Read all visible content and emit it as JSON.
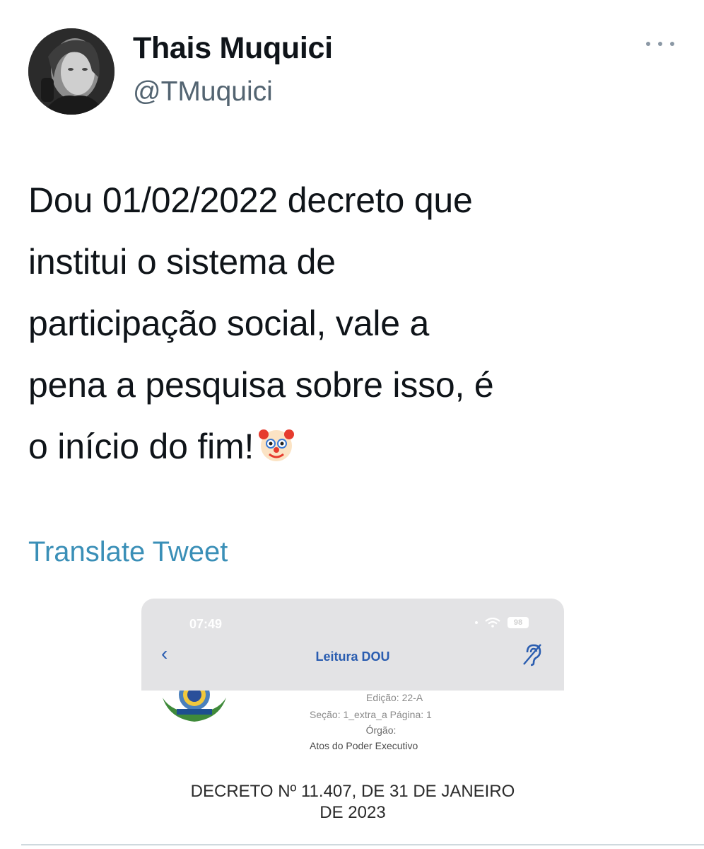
{
  "tweet": {
    "display_name": "Thais Muquici",
    "handle": "@TMuquici",
    "text": "Dou 01/02/2022 decreto que\ninstitui o sistema de\nparticipação social, vale a\npena a pesquisa sobre isso, é\no início do fim!",
    "emoji": "clown-face-emoji",
    "translate_label": "Translate Tweet",
    "link_color": "#3a8fb7"
  },
  "embedded_image": {
    "status_time": "07:49",
    "battery": "98",
    "nav_title": "Leitura DOU",
    "back_glyph": "‹",
    "edicao": "Edição: 22-A",
    "secao": "Seção: 1_extra_a    Página: 1",
    "orgao_label": "Órgão:",
    "orgao": "Atos do Poder Executivo",
    "decree_title": "DECRETO Nº 11.407, DE 31 DE JANEIRO\nDE 2023",
    "nav_color": "#2a5db0"
  }
}
